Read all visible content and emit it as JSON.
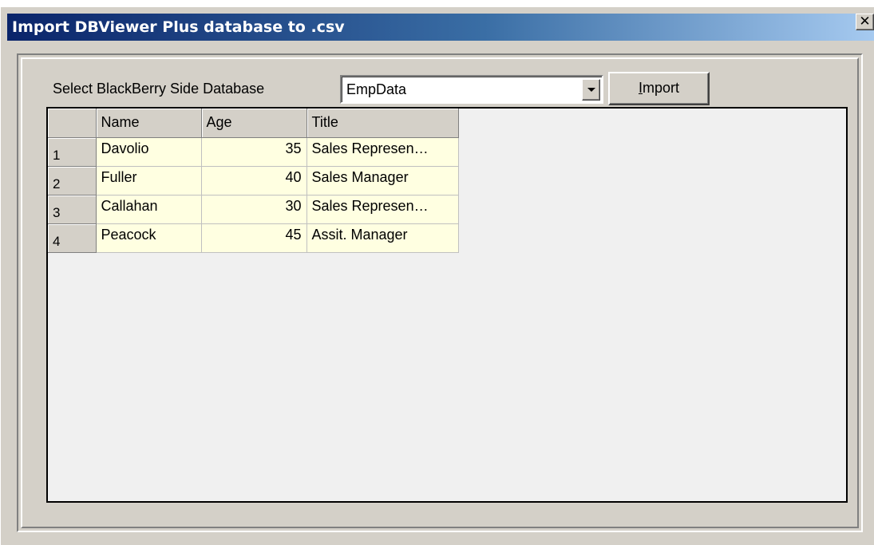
{
  "window": {
    "title": "Import DBViewer Plus database to .csv",
    "close_label": "✕"
  },
  "form": {
    "select_label": "Select BlackBerry Side Database",
    "database_value": "EmpData",
    "import_label": "Import"
  },
  "grid": {
    "columns": [
      "Name",
      "Age",
      "Title"
    ],
    "rows": [
      {
        "num": "1",
        "name": "Davolio",
        "age": "35",
        "title": "Sales Represen…"
      },
      {
        "num": "2",
        "name": "Fuller",
        "age": "40",
        "title": "Sales Manager"
      },
      {
        "num": "3",
        "name": "Callahan",
        "age": "30",
        "title": "Sales Represen…"
      },
      {
        "num": "4",
        "name": "Peacock",
        "age": "45",
        "title": "Assit. Manager"
      }
    ]
  },
  "colors": {
    "title_gradient_start": "#0a246a",
    "title_gradient_end": "#a6caf0",
    "face": "#d4d0c8",
    "cell_background": "#ffffe1",
    "grid_background": "#f0f0f0"
  }
}
